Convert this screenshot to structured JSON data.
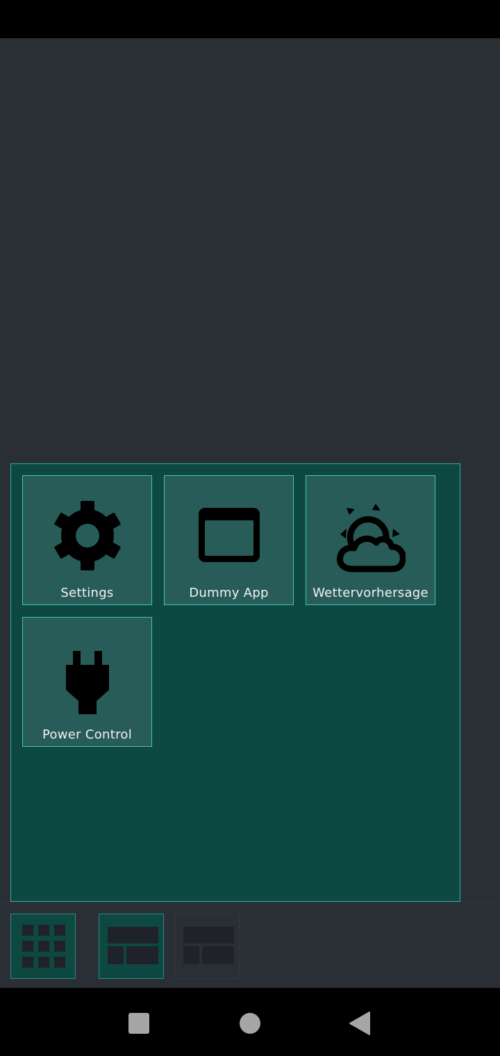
{
  "launcher": {
    "apps": [
      {
        "label": "Settings",
        "icon": "gear-icon"
      },
      {
        "label": "Dummy App",
        "icon": "window-icon"
      },
      {
        "label": "Wettervorhersage",
        "icon": "cloud-sun-icon"
      },
      {
        "label": "Power Control",
        "icon": "plug-icon"
      }
    ]
  },
  "bottom_bar": {
    "pages": [
      {
        "icon": "grid-icon",
        "state": "active"
      },
      {
        "icon": "layout-icon",
        "state": "active"
      },
      {
        "icon": "layout-icon",
        "state": "inactive"
      }
    ]
  },
  "nav": {
    "buttons": [
      "recents-square-icon",
      "home-circle-icon",
      "back-triangle-icon"
    ]
  },
  "colors": {
    "background": "#2a2e35",
    "panel": "#0e4843",
    "tile": "#285c58",
    "accent": "#3ec9ac"
  }
}
